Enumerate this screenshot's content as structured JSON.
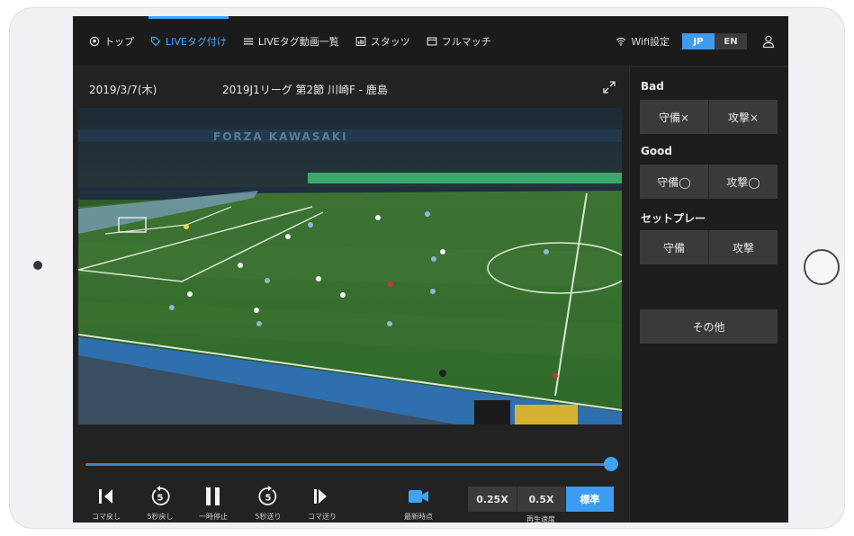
{
  "nav": {
    "items": [
      {
        "label": "トップ",
        "icon": "football-icon"
      },
      {
        "label": "LIVEタグ付け",
        "icon": "tag-icon"
      },
      {
        "label": "LIVEタグ動画一覧",
        "icon": "list-icon"
      },
      {
        "label": "スタッツ",
        "icon": "stats-icon"
      },
      {
        "label": "フルマッチ",
        "icon": "film-icon"
      }
    ],
    "active_index": 1
  },
  "toolbar": {
    "wifi_label": "Wifi設定",
    "lang_jp": "JP",
    "lang_en": "EN",
    "active_lang": "JP"
  },
  "match": {
    "date": "2019/3/7(木)",
    "title": "2019J1リーグ 第2節 川崎F - 鹿島"
  },
  "video": {
    "banner_text": "FORZA KAWASAKI",
    "seek_progress": 1.0
  },
  "controls": {
    "prev_frame": "コマ戻し",
    "back5": "5秒戻し",
    "back5_num": "5",
    "pause": "一時停止",
    "fwd5": "5秒送り",
    "fwd5_num": "5",
    "next_frame": "コマ送り",
    "latest": "最新時点",
    "speed_label": "再生速度",
    "speeds": [
      "0.25X",
      "0.5X",
      "標準"
    ],
    "active_speed": "標準"
  },
  "side": {
    "bad_title": "Bad",
    "bad_defense": "守備×",
    "bad_attack": "攻撃×",
    "good_title": "Good",
    "good_defense": "守備◯",
    "good_attack": "攻撃◯",
    "setplay_title": "セットプレー",
    "setplay_defense": "守備",
    "setplay_attack": "攻撃",
    "other": "その他"
  },
  "colors": {
    "accent": "#3d9cf0",
    "background": "#1f1f1f",
    "button": "#3a3a3a"
  }
}
